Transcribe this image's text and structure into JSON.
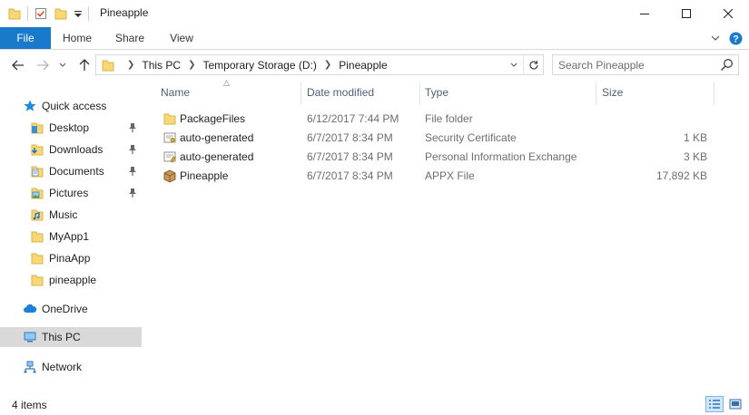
{
  "window": {
    "title": "Pineapple"
  },
  "ribbon": {
    "tabs": [
      "File",
      "Home",
      "Share",
      "View"
    ]
  },
  "address": {
    "crumbs": [
      "This PC",
      "Temporary Storage (D:)",
      "Pineapple"
    ]
  },
  "search": {
    "placeholder": "Search Pineapple"
  },
  "sidebar": {
    "quick_access": "Quick access",
    "pinned": [
      {
        "label": "Desktop",
        "icon": "desktop-folder-icon"
      },
      {
        "label": "Downloads",
        "icon": "downloads-folder-icon"
      },
      {
        "label": "Documents",
        "icon": "documents-folder-icon"
      },
      {
        "label": "Pictures",
        "icon": "pictures-folder-icon"
      }
    ],
    "recent": [
      {
        "label": "Music",
        "icon": "music-folder-icon"
      },
      {
        "label": "MyApp1",
        "icon": "folder-icon"
      },
      {
        "label": "PinaApp",
        "icon": "folder-icon"
      },
      {
        "label": "pineapple",
        "icon": "folder-icon"
      }
    ],
    "onedrive": "OneDrive",
    "this_pc": "This PC",
    "network": "Network"
  },
  "columns": {
    "name": "Name",
    "date": "Date modified",
    "type": "Type",
    "size": "Size"
  },
  "files": [
    {
      "name": "PackageFiles",
      "date": "6/12/2017 7:44 PM",
      "type": "File folder",
      "size": "",
      "icon": "folder-icon"
    },
    {
      "name": "auto-generated",
      "date": "6/7/2017 8:34 PM",
      "type": "Security Certificate",
      "size": "1 KB",
      "icon": "certificate-icon"
    },
    {
      "name": "auto-generated",
      "date": "6/7/2017 8:34 PM",
      "type": "Personal Information Exchange",
      "size": "3 KB",
      "icon": "pfx-icon"
    },
    {
      "name": "Pineapple",
      "date": "6/7/2017 8:34 PM",
      "type": "APPX File",
      "size": "17,892 KB",
      "icon": "package-icon"
    }
  ],
  "status": {
    "item_count": "4 items"
  },
  "colors": {
    "accent": "#1979ca",
    "selected_nav": "#d9d9d9",
    "folder": "#f8d775"
  }
}
